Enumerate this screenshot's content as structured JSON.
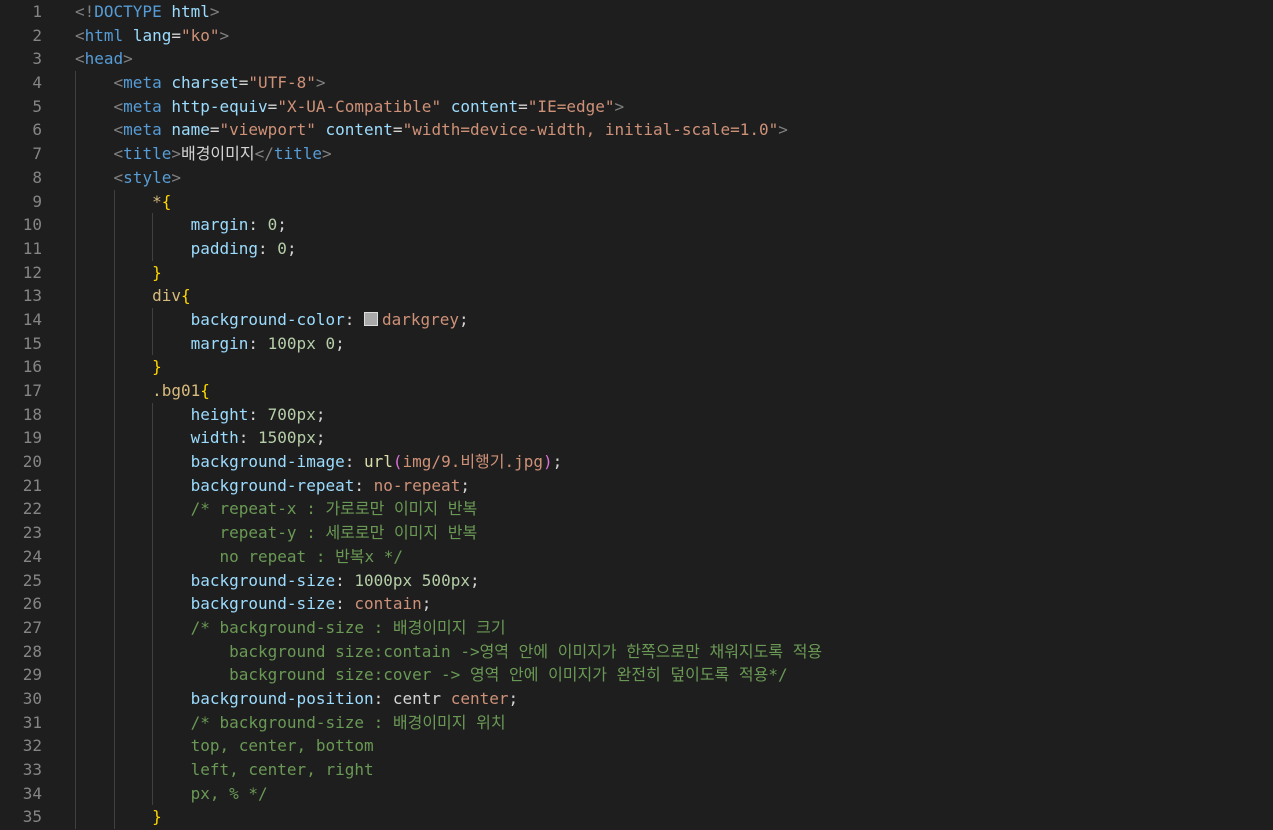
{
  "editor": {
    "background": "#1e1e1e",
    "swatch_color": "#a9a9a9",
    "lines": [
      {
        "n": "1",
        "t": [
          [
            "punc",
            "<!"
          ],
          [
            "tag",
            "DOCTYPE"
          ],
          [
            "txt",
            " "
          ],
          [
            "attr",
            "html"
          ],
          [
            "punc",
            ">"
          ]
        ]
      },
      {
        "n": "2",
        "t": [
          [
            "punc",
            "<"
          ],
          [
            "tag",
            "html"
          ],
          [
            "txt",
            " "
          ],
          [
            "attr",
            "lang"
          ],
          [
            "txt",
            "="
          ],
          [
            "str",
            "\"ko\""
          ],
          [
            "punc",
            ">"
          ]
        ]
      },
      {
        "n": "3",
        "t": [
          [
            "punc",
            "<"
          ],
          [
            "tag",
            "head"
          ],
          [
            "punc",
            ">"
          ]
        ]
      },
      {
        "n": "4",
        "t": [
          [
            "txt",
            "    "
          ],
          [
            "punc",
            "<"
          ],
          [
            "tag",
            "meta"
          ],
          [
            "txt",
            " "
          ],
          [
            "attr",
            "charset"
          ],
          [
            "txt",
            "="
          ],
          [
            "str",
            "\"UTF-8\""
          ],
          [
            "punc",
            ">"
          ]
        ]
      },
      {
        "n": "5",
        "t": [
          [
            "txt",
            "    "
          ],
          [
            "punc",
            "<"
          ],
          [
            "tag",
            "meta"
          ],
          [
            "txt",
            " "
          ],
          [
            "attr",
            "http-equiv"
          ],
          [
            "txt",
            "="
          ],
          [
            "str",
            "\"X-UA-Compatible\""
          ],
          [
            "txt",
            " "
          ],
          [
            "attr",
            "content"
          ],
          [
            "txt",
            "="
          ],
          [
            "str",
            "\"IE=edge\""
          ],
          [
            "punc",
            ">"
          ]
        ]
      },
      {
        "n": "6",
        "t": [
          [
            "txt",
            "    "
          ],
          [
            "punc",
            "<"
          ],
          [
            "tag",
            "meta"
          ],
          [
            "txt",
            " "
          ],
          [
            "attr",
            "name"
          ],
          [
            "txt",
            "="
          ],
          [
            "str",
            "\"viewport\""
          ],
          [
            "txt",
            " "
          ],
          [
            "attr",
            "content"
          ],
          [
            "txt",
            "="
          ],
          [
            "str",
            "\"width=device-width, initial-scale=1.0\""
          ],
          [
            "punc",
            ">"
          ]
        ]
      },
      {
        "n": "7",
        "t": [
          [
            "txt",
            "    "
          ],
          [
            "punc",
            "<"
          ],
          [
            "tag",
            "title"
          ],
          [
            "punc",
            ">"
          ],
          [
            "txt",
            "배경이미지"
          ],
          [
            "punc",
            "</"
          ],
          [
            "tag",
            "title"
          ],
          [
            "punc",
            ">"
          ]
        ]
      },
      {
        "n": "8",
        "t": [
          [
            "txt",
            "    "
          ],
          [
            "punc",
            "<"
          ],
          [
            "tag",
            "style"
          ],
          [
            "punc",
            ">"
          ]
        ]
      },
      {
        "n": "9",
        "t": [
          [
            "txt",
            "        "
          ],
          [
            "sel",
            "*"
          ],
          [
            "brace",
            "{"
          ]
        ]
      },
      {
        "n": "10",
        "t": [
          [
            "txt",
            "            "
          ],
          [
            "prop",
            "margin"
          ],
          [
            "txt",
            ": "
          ],
          [
            "num",
            "0"
          ],
          [
            "txt",
            ";"
          ]
        ]
      },
      {
        "n": "11",
        "t": [
          [
            "txt",
            "            "
          ],
          [
            "prop",
            "padding"
          ],
          [
            "txt",
            ": "
          ],
          [
            "num",
            "0"
          ],
          [
            "txt",
            ";"
          ]
        ]
      },
      {
        "n": "12",
        "t": [
          [
            "txt",
            "        "
          ],
          [
            "brace",
            "}"
          ]
        ]
      },
      {
        "n": "13",
        "t": [
          [
            "txt",
            "        "
          ],
          [
            "sel",
            "div"
          ],
          [
            "brace",
            "{"
          ]
        ]
      },
      {
        "n": "14",
        "t": [
          [
            "txt",
            "            "
          ],
          [
            "prop",
            "background-color"
          ],
          [
            "txt",
            ": "
          ],
          [
            "swatch",
            ""
          ],
          [
            "str",
            "darkgrey"
          ],
          [
            "txt",
            ";"
          ]
        ]
      },
      {
        "n": "15",
        "t": [
          [
            "txt",
            "            "
          ],
          [
            "prop",
            "margin"
          ],
          [
            "txt",
            ": "
          ],
          [
            "num",
            "100px"
          ],
          [
            "txt",
            " "
          ],
          [
            "num",
            "0"
          ],
          [
            "txt",
            ";"
          ]
        ]
      },
      {
        "n": "16",
        "t": [
          [
            "txt",
            "        "
          ],
          [
            "brace",
            "}"
          ]
        ]
      },
      {
        "n": "17",
        "t": [
          [
            "txt",
            "        "
          ],
          [
            "sel",
            ".bg01"
          ],
          [
            "brace",
            "{"
          ]
        ]
      },
      {
        "n": "18",
        "t": [
          [
            "txt",
            "            "
          ],
          [
            "prop",
            "height"
          ],
          [
            "txt",
            ": "
          ],
          [
            "num",
            "700px"
          ],
          [
            "txt",
            ";"
          ]
        ]
      },
      {
        "n": "19",
        "t": [
          [
            "txt",
            "            "
          ],
          [
            "prop",
            "width"
          ],
          [
            "txt",
            ": "
          ],
          [
            "num",
            "1500px"
          ],
          [
            "txt",
            ";"
          ]
        ]
      },
      {
        "n": "20",
        "t": [
          [
            "txt",
            "            "
          ],
          [
            "prop",
            "background-image"
          ],
          [
            "txt",
            ": "
          ],
          [
            "fn",
            "url"
          ],
          [
            "paren",
            "("
          ],
          [
            "str",
            "img/9.비행기.jpg"
          ],
          [
            "paren",
            ")"
          ],
          [
            "txt",
            ";"
          ]
        ]
      },
      {
        "n": "21",
        "t": [
          [
            "txt",
            "            "
          ],
          [
            "prop",
            "background-repeat"
          ],
          [
            "txt",
            ": "
          ],
          [
            "str",
            "no-repeat"
          ],
          [
            "txt",
            ";"
          ]
        ]
      },
      {
        "n": "22",
        "t": [
          [
            "txt",
            "            "
          ],
          [
            "cmt",
            "/* repeat-x : 가로로만 이미지 반복"
          ]
        ]
      },
      {
        "n": "23",
        "t": [
          [
            "txt",
            "            "
          ],
          [
            "cmt",
            "   repeat-y : 세로로만 이미지 반복"
          ]
        ]
      },
      {
        "n": "24",
        "t": [
          [
            "txt",
            "            "
          ],
          [
            "cmt",
            "   no repeat : 반복x */"
          ]
        ]
      },
      {
        "n": "25",
        "t": [
          [
            "txt",
            "            "
          ],
          [
            "prop",
            "background-size"
          ],
          [
            "txt",
            ": "
          ],
          [
            "num",
            "1000px"
          ],
          [
            "txt",
            " "
          ],
          [
            "num",
            "500px"
          ],
          [
            "txt",
            ";"
          ]
        ]
      },
      {
        "n": "26",
        "t": [
          [
            "txt",
            "            "
          ],
          [
            "prop",
            "background-size"
          ],
          [
            "txt",
            ": "
          ],
          [
            "str",
            "contain"
          ],
          [
            "txt",
            ";"
          ]
        ]
      },
      {
        "n": "27",
        "t": [
          [
            "txt",
            "            "
          ],
          [
            "cmt",
            "/* background-size : 배경이미지 크기"
          ]
        ]
      },
      {
        "n": "28",
        "t": [
          [
            "txt",
            "            "
          ],
          [
            "cmt",
            "    background size:contain ->영역 안에 이미지가 한쪽으로만 채워지도록 적용"
          ]
        ]
      },
      {
        "n": "29",
        "t": [
          [
            "txt",
            "            "
          ],
          [
            "cmt",
            "    background size:cover -> 영역 안에 이미지가 완전히 덮이도록 적용*/"
          ]
        ]
      },
      {
        "n": "30",
        "t": [
          [
            "txt",
            "            "
          ],
          [
            "prop",
            "background-position"
          ],
          [
            "txt",
            ": centr "
          ],
          [
            "str",
            "center"
          ],
          [
            "txt",
            ";"
          ]
        ]
      },
      {
        "n": "31",
        "t": [
          [
            "txt",
            "            "
          ],
          [
            "cmt",
            "/* background-size : 배경이미지 위치"
          ]
        ]
      },
      {
        "n": "32",
        "t": [
          [
            "txt",
            "            "
          ],
          [
            "cmt",
            "top, center, bottom"
          ]
        ]
      },
      {
        "n": "33",
        "t": [
          [
            "txt",
            "            "
          ],
          [
            "cmt",
            "left, center, right"
          ]
        ]
      },
      {
        "n": "34",
        "t": [
          [
            "txt",
            "            "
          ],
          [
            "cmt",
            "px, % */"
          ]
        ]
      },
      {
        "n": "35",
        "t": [
          [
            "txt",
            "        "
          ],
          [
            "brace",
            "}"
          ]
        ]
      }
    ]
  }
}
